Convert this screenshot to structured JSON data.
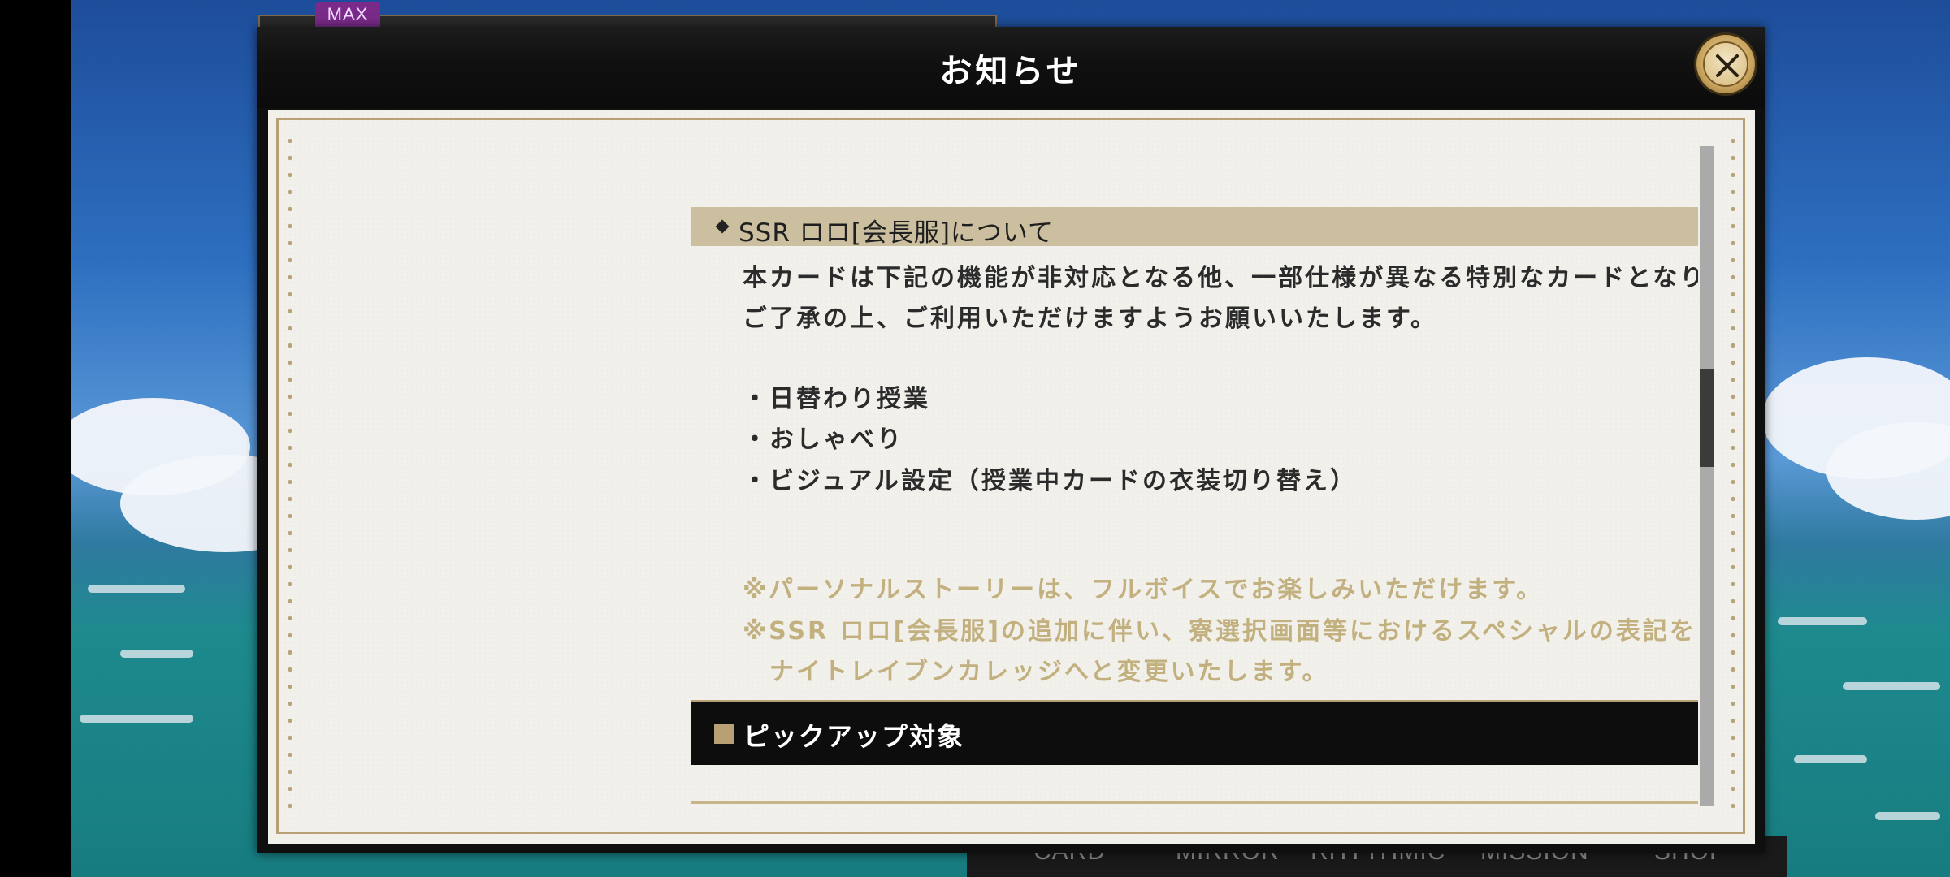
{
  "background": {
    "max_badge": "MAX",
    "bottom_nav": [
      "CARD",
      "MIRROR",
      "RHYTHMIC",
      "MISSION",
      "SHOP"
    ]
  },
  "modal": {
    "title": "お知らせ",
    "section_heading": "SSR ロロ[会長服]について",
    "intro_lines": [
      "本カードは下記の機能が非対応となる他、一部仕様が異なる特別なカードとなります。",
      "ご了承の上、ご利用いただけますようお願いいたします。"
    ],
    "unsupported_features": [
      "・日替わり授業",
      "・おしゃべり",
      "・ビジュアル設定（授業中カードの衣装切り替え）"
    ],
    "notes": [
      "※パーソナルストーリーは、フルボイスでお楽しみいただけます。",
      "※SSR ロロ[会長服]の追加に伴い、寮選択画面等におけるスペシャルの表記を",
      "　ナイトレイブンカレッジへと変更いたします。"
    ],
    "pickup_heading": "ピックアップ対象"
  },
  "colors": {
    "accent_gold": "#b7a074",
    "heading_bg": "#cbbf9f",
    "note_text": "#c2b07f",
    "body_text": "#2b2b2b",
    "paper": "#f2f0eb"
  }
}
